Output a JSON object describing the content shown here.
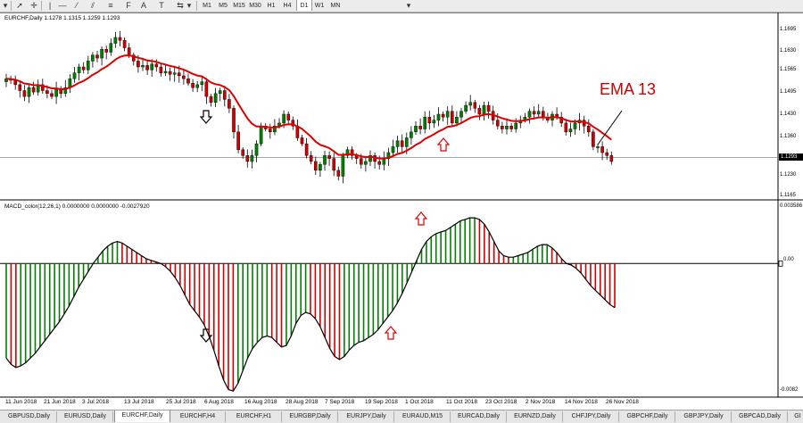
{
  "toolbar": {
    "icons": [
      "pointer-icon",
      "crosshair-icon",
      "vertical-line-icon",
      "horizontal-line-icon",
      "trendline-icon",
      "channel-icon",
      "fibonacci-icon",
      "text-icon",
      "label-icon",
      "arrows-icon"
    ],
    "text_tool": "A",
    "label_tool": "T",
    "timeframes": [
      "M1",
      "M5",
      "M15",
      "M30",
      "H1",
      "H4",
      "D1",
      "W1",
      "MN"
    ],
    "active_timeframe": "D1"
  },
  "chart": {
    "header": "EURCHF,Daily  1.1278 1.1315 1.1259 1.1293",
    "price_labels": [
      "1.1695",
      "1.1630",
      "1.1565",
      "1.1495",
      "1.1430",
      "1.1360",
      "1.1230",
      "1.1165"
    ],
    "current_price": "1.1293",
    "annotation": "EMA 13",
    "dates": [
      "11 Jun 2018",
      "21 Jun 2018",
      "3 Jul 2018",
      "13 Jul 2018",
      "25 Jul 2018",
      "6 Aug 2018",
      "16 Aug 2018",
      "28 Aug 2018",
      "7 Sep 2018",
      "19 Sep 2018",
      "1 Oct 2018",
      "11 Oct 2018",
      "23 Oct 2018",
      "2 Nov 2018",
      "14 Nov 2018",
      "26 Nov 2018"
    ]
  },
  "macd": {
    "header": "MACD_color(12,26,1) 0.0000000 0.0000000 -0.0027920",
    "top_label": "0.003586",
    "zero_label": "0.00",
    "bottom_label": "-0.0082"
  },
  "tabs": [
    "GBPUSD,Daily",
    "EURUSD,Daily",
    "EURCHF,Daily",
    "EURCHF,H4",
    "EURCHF,H1",
    "EURGBP,Daily",
    "EURJPY,Daily",
    "EURAUD,M15",
    "EURCAD,Daily",
    "EURNZD,Daily",
    "CHFJPY,Daily",
    "GBPCHF,Daily",
    "GBPJPY,Daily",
    "GBPCAD,Daily",
    "GI"
  ],
  "active_tab": "EURCHF,Daily",
  "colors": {
    "bull": "#008000",
    "bear": "#d00000",
    "ema": "#e00000",
    "arrow_red": "#e00000",
    "arrow_black": "#000000"
  },
  "chart_data": {
    "type": "candlestick",
    "symbol": "EURCHF",
    "timeframe": "Daily",
    "closes": [
      1.156,
      1.1555,
      1.154,
      1.152,
      1.15,
      1.153,
      1.1515,
      1.154,
      1.152,
      1.151,
      1.15,
      1.1525,
      1.151,
      1.153,
      1.156,
      1.158,
      1.16,
      1.159,
      1.162,
      1.164,
      1.163,
      1.166,
      1.165,
      1.168,
      1.17,
      1.169,
      1.1665,
      1.164,
      1.162,
      1.16,
      1.1605,
      1.159,
      1.161,
      1.16,
      1.158,
      1.1585,
      1.1575,
      1.158,
      1.157,
      1.156,
      1.1545,
      1.153,
      1.154,
      1.155,
      1.15,
      1.148,
      1.151,
      1.152,
      1.149,
      1.146,
      1.138,
      1.132,
      1.13,
      1.128,
      1.13,
      1.134,
      1.14,
      1.139,
      1.138,
      1.14,
      1.141,
      1.144,
      1.142,
      1.14,
      1.136,
      1.134,
      1.13,
      1.128,
      1.125,
      1.127,
      1.13,
      1.129,
      1.125,
      1.123,
      1.13,
      1.132,
      1.13,
      1.129,
      1.127,
      1.128,
      1.13,
      1.128,
      1.127,
      1.129,
      1.131,
      1.133,
      1.135,
      1.133,
      1.136,
      1.138,
      1.14,
      1.139,
      1.143,
      1.141,
      1.142,
      1.144,
      1.143,
      1.145,
      1.141,
      1.143,
      1.145,
      1.147,
      1.148,
      1.146,
      1.144,
      1.147,
      1.145,
      1.142,
      1.14,
      1.139,
      1.14,
      1.139,
      1.141,
      1.142,
      1.143,
      1.145,
      1.144,
      1.145,
      1.143,
      1.142,
      1.144,
      1.143,
      1.141,
      1.138,
      1.139,
      1.141,
      1.142,
      1.14,
      1.138,
      1.133,
      1.133,
      1.131,
      1.13,
      1.128
    ],
    "ema_period": 13,
    "macd_params": [
      12,
      26,
      1
    ],
    "macd_values": [
      -0.006,
      -0.0064,
      -0.0066,
      -0.0065,
      -0.0063,
      -0.006,
      -0.0057,
      -0.0053,
      -0.0049,
      -0.0045,
      -0.0041,
      -0.0037,
      -0.0032,
      -0.0027,
      -0.0021,
      -0.0015,
      -0.001,
      -0.0005,
      0.0,
      0.0004,
      0.0008,
      0.0011,
      0.0013,
      0.0014,
      0.0013,
      0.0011,
      0.0009,
      0.0007,
      0.0005,
      0.0003,
      0.0002,
      0.0001,
      0.0,
      -0.0002,
      -0.0005,
      -0.0009,
      -0.0014,
      -0.002,
      -0.0026,
      -0.003,
      -0.0034,
      -0.0039,
      -0.0046,
      -0.0055,
      -0.0065,
      -0.0074,
      -0.008,
      -0.0081,
      -0.0076,
      -0.0068,
      -0.006,
      -0.0054,
      -0.005,
      -0.0047,
      -0.0046,
      -0.0047,
      -0.005,
      -0.0053,
      -0.0052,
      -0.0046,
      -0.0038,
      -0.0033,
      -0.0031,
      -0.0032,
      -0.0035,
      -0.004,
      -0.0047,
      -0.0054,
      -0.0059,
      -0.0061,
      -0.0059,
      -0.0055,
      -0.0052,
      -0.005,
      -0.0049,
      -0.0047,
      -0.0045,
      -0.0042,
      -0.0038,
      -0.0034,
      -0.003,
      -0.0025,
      -0.0019,
      -0.0012,
      -0.0005,
      0.0002,
      0.0009,
      0.0014,
      0.0017,
      0.0019,
      0.002,
      0.0021,
      0.0023,
      0.0025,
      0.0027,
      0.0028,
      0.0029,
      0.0029,
      0.0028,
      0.0025,
      0.002,
      0.0014,
      0.0008,
      0.0005,
      0.0004,
      0.0004,
      0.0005,
      0.0006,
      0.0007,
      0.0009,
      0.0011,
      0.0012,
      0.0012,
      0.001,
      0.0007,
      0.0003,
      0.0,
      -0.0001,
      -0.0003,
      -0.0006,
      -0.001,
      -0.0014,
      -0.0017,
      -0.002,
      -0.0023,
      -0.0026,
      -0.0028
    ],
    "price_range": [
      1.1165,
      1.173
    ],
    "macd_range": [
      -0.0082,
      0.003586
    ]
  }
}
